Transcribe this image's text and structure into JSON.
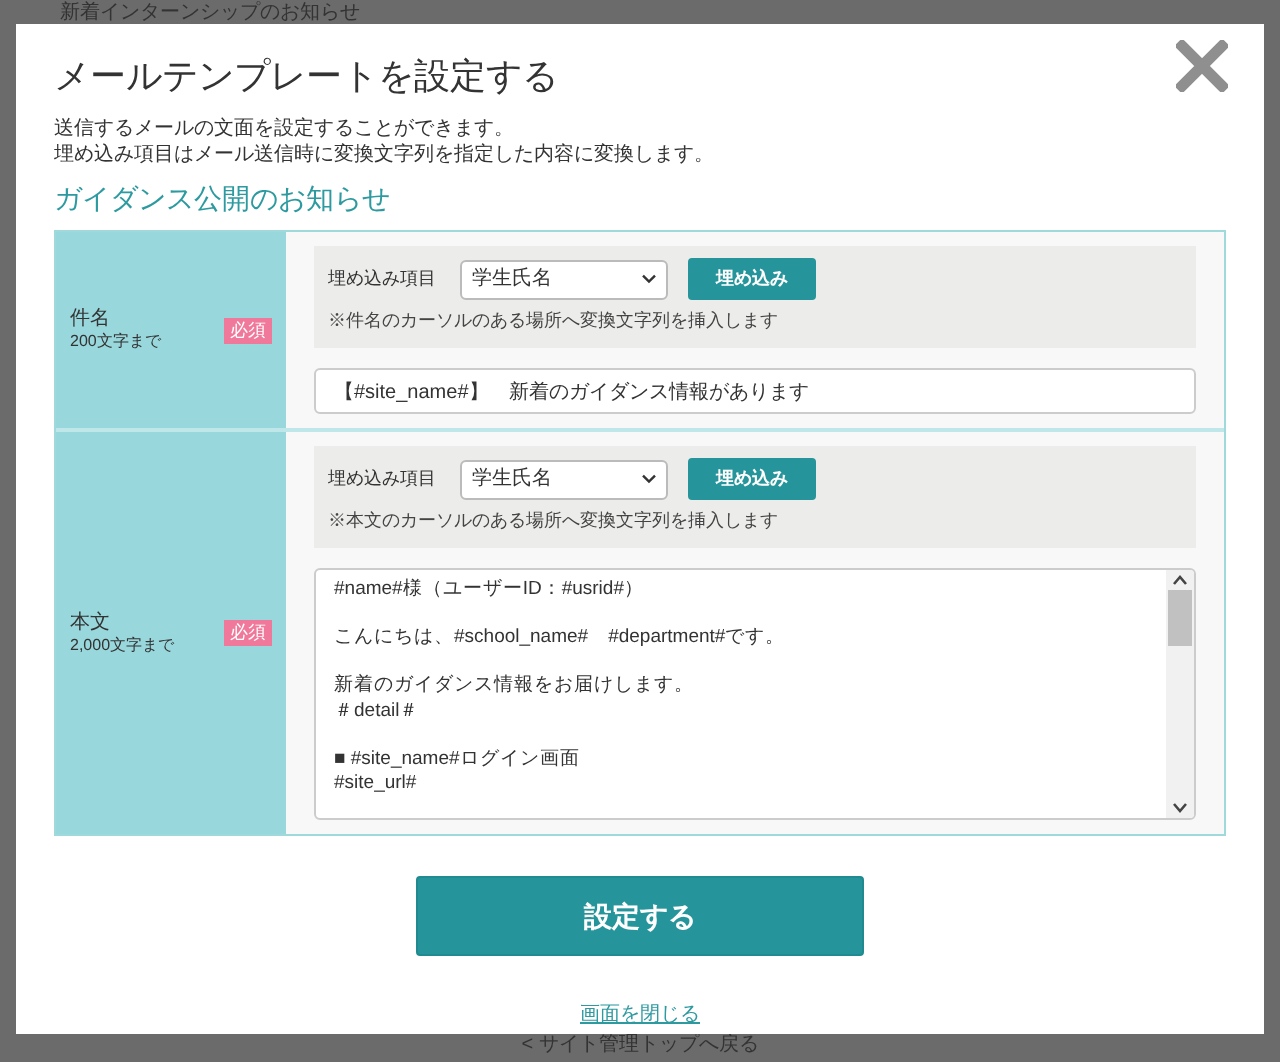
{
  "background_page": {
    "top_text": "新着インターンシップのお知らせ",
    "bottom_link": "< サイト管理トップへ戻る"
  },
  "dialog": {
    "title": "メールテンプレートを設定する",
    "description": [
      "送信するメールの文面を設定することができます。",
      "埋め込み項目はメール送信時に変換文字列を指定した内容に変換します。"
    ],
    "template_name": "ガイダンス公開のお知らせ",
    "fields": [
      {
        "kind": "input",
        "label": "件名",
        "limit": "200文字まで",
        "required_badge": "必須",
        "embed_label": "埋め込み項目",
        "embed_select": "学生氏名",
        "embed_button": "埋め込み",
        "note": "※件名のカーソルのある場所へ変換文字列を挿入します",
        "value": "【#site_name#】　新着のガイダンス情報があります"
      },
      {
        "kind": "textarea",
        "label": "本文",
        "limit": "2,000文字まで",
        "required_badge": "必須",
        "embed_label": "埋め込み項目",
        "embed_select": "学生氏名",
        "embed_button": "埋め込み",
        "note": "※本文のカーソルのある場所へ変換文字列を挿入します",
        "paragraphs": [
          [
            "#name#様（ユーザーID：#usrid#）"
          ],
          [
            "こんにちは、#school_name#　#department#です。"
          ],
          [
            "新着のガイダンス情報をお届けします。",
            "＃detail＃"
          ],
          [
            "■ #site_name#ログイン画面",
            "#site_url#"
          ]
        ]
      }
    ],
    "submit_button": "設定する",
    "close_link": "画面を閉じる"
  }
}
